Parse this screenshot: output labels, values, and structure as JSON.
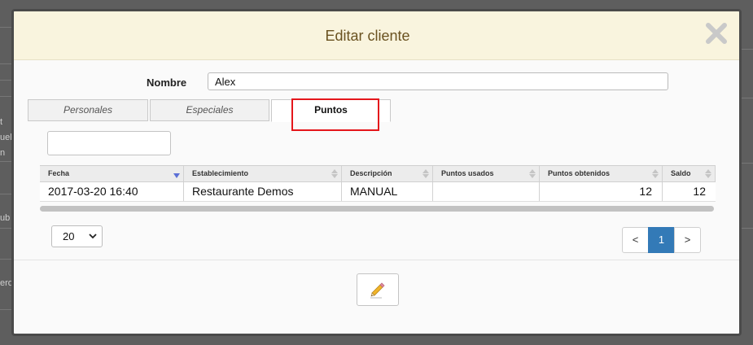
{
  "background": {
    "fragments": [
      "t",
      "uel",
      "n",
      "ub",
      "ero"
    ]
  },
  "modal": {
    "title": "Editar cliente",
    "close_icon": "close-x-icon"
  },
  "form": {
    "name_label": "Nombre",
    "name_value": "Alex"
  },
  "tabs": [
    {
      "label": "Personales",
      "active": false
    },
    {
      "label": "Especiales",
      "active": false
    },
    {
      "label": "Puntos",
      "active": true
    }
  ],
  "search": {
    "value": ""
  },
  "table": {
    "columns": [
      "Fecha",
      "Establecimiento",
      "Descripción",
      "Puntos usados",
      "Puntos obtenidos",
      "Saldo"
    ],
    "rows": [
      {
        "fecha": "2017-03-20 16:40",
        "establecimiento": "Restaurante Demos",
        "descripcion": "MANUAL",
        "puntos_usados": "",
        "puntos_obtenidos": "12",
        "saldo": "12"
      }
    ]
  },
  "pagination": {
    "page_size": "20",
    "prev": "<",
    "current": "1",
    "next": ">"
  },
  "footer": {
    "edit_icon": "pencil-icon"
  },
  "colors": {
    "header_bg": "#f9f4de",
    "title": "#6a5220",
    "highlight": "#e4161b",
    "active_page": "#337ab7"
  }
}
